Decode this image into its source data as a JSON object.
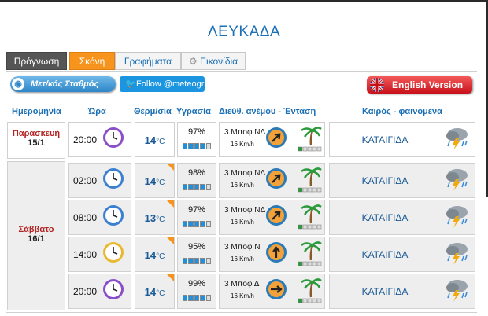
{
  "page": {
    "title": "ΛΕΥΚΑΔΑ"
  },
  "tabs": [
    {
      "label": "Πρόγνωση",
      "style": "dark"
    },
    {
      "label": "Σκόνη",
      "style": "orange"
    },
    {
      "label": "Γραφήματα",
      "style": "light"
    },
    {
      "label": "Εικονίδια",
      "style": "light",
      "icon": "gear-icon"
    }
  ],
  "buttons": {
    "stations": "Μετ/κός Σταθμός",
    "twitter": "Follow @meteogr",
    "english": "English Version"
  },
  "headers": {
    "date": "Ημερομηνία",
    "time": "Ώρα",
    "temp": "Θερμ/σία",
    "humidity": "Υγρασία",
    "wind": "Διεύθ. ανέμου - Ένταση",
    "weather": "Καιρός - φαινόμενα"
  },
  "colors": {
    "accent": "#1a6fb5",
    "orange": "#f7941d",
    "day_name": "#b22222"
  },
  "days": [
    {
      "name": "Παρασκευή",
      "date": "15/1"
    },
    {
      "name": "Σάββατο",
      "date": "16/1"
    }
  ],
  "rows": [
    {
      "time": "20:00",
      "clock_icon": "clock-purple-icon",
      "temp": "14",
      "temp_unit": "°C",
      "humidity": "97%",
      "humidity_level": 0.8,
      "wind": "3 Μποφ ΝΔ",
      "wind_speed": "16 Km/h",
      "wind_direction_icon": "arrow-northeast-icon",
      "wind_level": 0.2,
      "weather": "ΚΑΤΑΙΓΙΔΑ",
      "weather_icon": "thunderstorm-icon"
    },
    {
      "time": "02:00",
      "clock_icon": "clock-blue-icon",
      "temp": "14",
      "temp_unit": "°C",
      "humidity": "98%",
      "humidity_level": 0.8,
      "wind": "3 Μποφ ΝΔ",
      "wind_speed": "16 Km/h",
      "wind_direction_icon": "arrow-northeast-icon",
      "wind_level": 0.2,
      "weather": "ΚΑΤΑΙΓΙΔΑ",
      "weather_icon": "thunderstorm-icon"
    },
    {
      "time": "08:00",
      "clock_icon": "clock-blue-icon",
      "temp": "13",
      "temp_unit": "°C",
      "humidity": "97%",
      "humidity_level": 0.8,
      "wind": "3 Μποφ ΝΔ",
      "wind_speed": "16 Km/h",
      "wind_direction_icon": "arrow-northeast-icon",
      "wind_level": 0.2,
      "weather": "ΚΑΤΑΙΓΙΔΑ",
      "weather_icon": "thunderstorm-icon"
    },
    {
      "time": "14:00",
      "clock_icon": "clock-yellow-icon",
      "temp": "14",
      "temp_unit": "°C",
      "humidity": "95%",
      "humidity_level": 0.8,
      "wind": "3 Μποφ Ν",
      "wind_speed": "16 Km/h",
      "wind_direction_icon": "arrow-north-icon",
      "wind_level": 0.2,
      "weather": "ΚΑΤΑΙΓΙΔΑ",
      "weather_icon": "thunderstorm-icon"
    },
    {
      "time": "20:00",
      "clock_icon": "clock-purple-icon",
      "temp": "14",
      "temp_unit": "°C",
      "humidity": "99%",
      "humidity_level": 0.8,
      "wind": "3 Μποφ Δ",
      "wind_speed": "16 Km/h",
      "wind_direction_icon": "arrow-east-icon",
      "wind_level": 0.2,
      "weather": "ΚΑΤΑΙΓΙΔΑ",
      "weather_icon": "thunderstorm-icon"
    }
  ]
}
